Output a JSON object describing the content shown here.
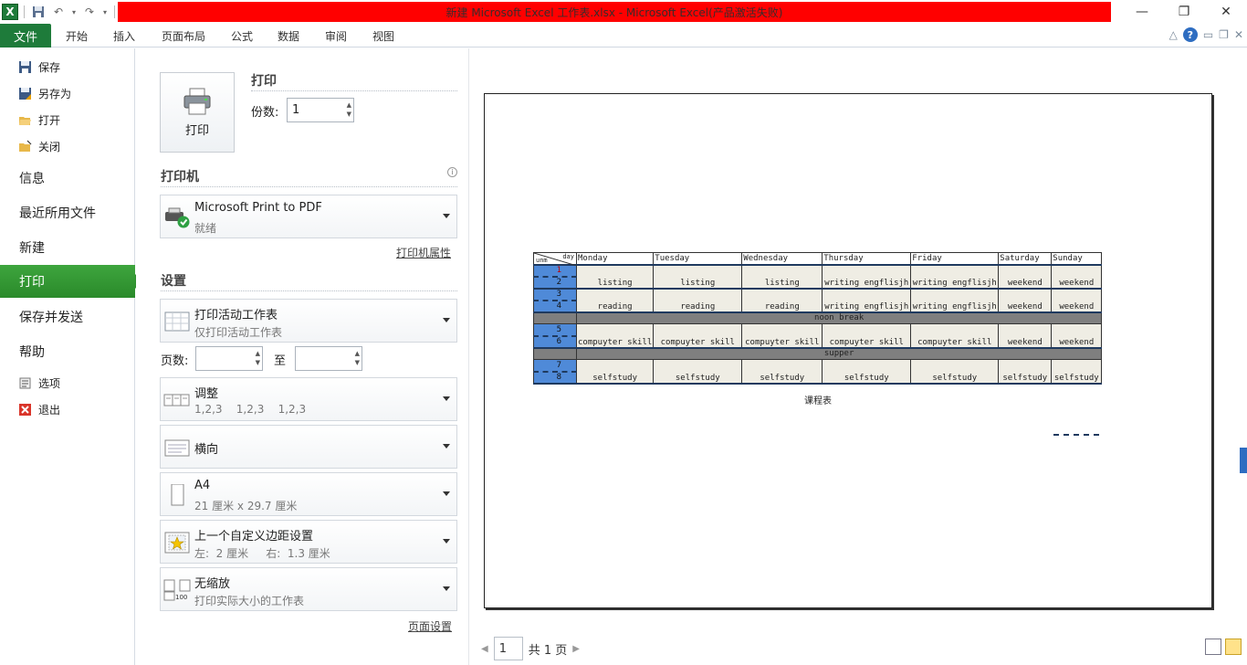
{
  "window": {
    "title": "新建 Microsoft Excel 工作表.xlsx - Microsoft Excel(产品激活失败)",
    "controls": {
      "minimize": "—",
      "restore": "❐",
      "close": "✕"
    }
  },
  "ribbon": {
    "file_tab": "文件",
    "tabs": [
      "开始",
      "插入",
      "页面布局",
      "公式",
      "数据",
      "审阅",
      "视图"
    ]
  },
  "backstage": {
    "small_items": [
      "保存",
      "另存为",
      "打开",
      "关闭"
    ],
    "big_items": [
      "信息",
      "最近所用文件",
      "新建",
      "打印",
      "保存并发送",
      "帮助"
    ],
    "active": "打印",
    "bottom_items": [
      "选项",
      "退出"
    ]
  },
  "print": {
    "button_label": "打印",
    "heading": "打印",
    "copies_label": "份数:",
    "copies_value": "1"
  },
  "printer": {
    "heading": "打印机",
    "name": "Microsoft Print to PDF",
    "status": "就绪",
    "properties_link": "打印机属性"
  },
  "settings": {
    "heading": "设置",
    "scope": {
      "title": "打印活动工作表",
      "sub": "仅打印活动工作表"
    },
    "pages_label": "页数:",
    "to_label": "至",
    "collate": {
      "title": "调整",
      "sub": "1,2,3    1,2,3    1,2,3"
    },
    "orientation": {
      "title": "横向"
    },
    "paper": {
      "title": "A4",
      "sub": "21 厘米 x 29.7 厘米"
    },
    "margins": {
      "title": "上一个自定义边距设置",
      "sub": "左:  2 厘米     右:  1.3 厘米"
    },
    "scaling": {
      "title": "无缩放",
      "sub": "打印实际大小的工作表"
    },
    "page_setup_link": "页面设置"
  },
  "preview": {
    "corner_top": "day",
    "corner_bottom": "unm",
    "days": [
      "Monday",
      "Tuesday",
      "Wednesday",
      "Thursday",
      "Friday",
      "Saturday",
      "Sunday"
    ],
    "rows": [
      {
        "nums": [
          "1",
          "2"
        ],
        "cells": [
          "listing",
          "listing",
          "listing",
          "writing engflisjh",
          "writing engflisjh",
          "weekend",
          "weekend"
        ]
      },
      {
        "nums": [
          "3",
          "4"
        ],
        "cells": [
          "reading",
          "reading",
          "reading",
          "writing engflisjh",
          "writing engflisjh",
          "weekend",
          "weekend"
        ]
      },
      {
        "break": "noon break"
      },
      {
        "nums": [
          "5",
          "6"
        ],
        "cells": [
          "compuyter skill",
          "compuyter skill",
          "compuyter skill",
          "compuyter skill",
          "compuyter skill",
          "weekend",
          "weekend"
        ]
      },
      {
        "break": "supper"
      },
      {
        "nums": [
          "7",
          "8"
        ],
        "cells": [
          "selfstudy",
          "selfstudy",
          "selfstudy",
          "selfstudy",
          "selfstudy",
          "selfstudy",
          "selfstudy"
        ]
      }
    ],
    "caption": "课程表"
  },
  "pager": {
    "current": "1",
    "total_label": "共 1 页"
  }
}
